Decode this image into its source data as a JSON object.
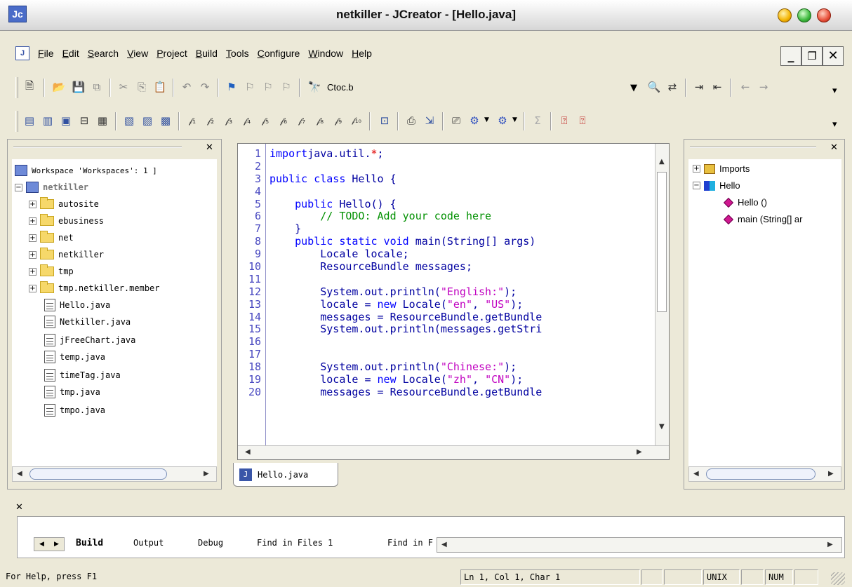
{
  "window": {
    "title": "netkiller - JCreator - [Hello.java]",
    "app_icon": "Jc"
  },
  "menubar": {
    "items": [
      "File",
      "Edit",
      "Search",
      "View",
      "Project",
      "Build",
      "Tools",
      "Configure",
      "Window",
      "Help"
    ],
    "doc_icon": "J"
  },
  "toolbar": {
    "search_combo": "Ctoc.b"
  },
  "workspace": {
    "header": "Workspace 'Workspaces': 1 ]",
    "project": "netkiller",
    "folders": [
      "autosite",
      "ebusiness",
      "net",
      "netkiller",
      "tmp",
      "tmp.netkiller.member"
    ],
    "files": [
      "Hello.java",
      "Netkiller.java",
      "jFreeChart.java",
      "temp.java",
      "timeTag.java",
      "tmp.java",
      "tmpo.java"
    ]
  },
  "editor": {
    "line_numbers": [
      "1",
      "2",
      "3",
      "4",
      "5",
      "6",
      "7",
      "8",
      "9",
      "10",
      "11",
      "12",
      "13",
      "14",
      "15",
      "16",
      "17",
      "18",
      "19",
      "20"
    ],
    "doc_tab": "Hello.java"
  },
  "outline": {
    "imports": "Imports",
    "class": "Hello",
    "members": [
      "Hello ()",
      "main (String[] ar"
    ]
  },
  "output": {
    "tabs": [
      "Build",
      "Output",
      "Debug",
      "Find in Files 1",
      "Find in F"
    ]
  },
  "statusbar": {
    "help": "For Help, press F1",
    "position": "Ln 1, Col 1, Char 1",
    "eol": "UNIX",
    "num": "NUM"
  }
}
